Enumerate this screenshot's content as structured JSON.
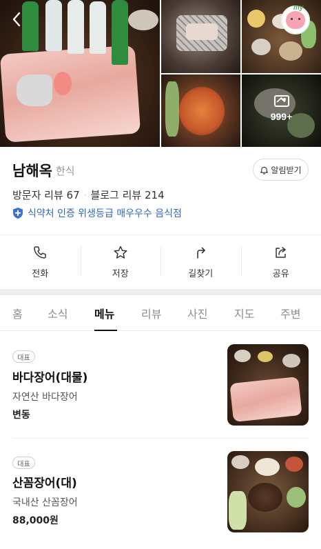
{
  "gallery": {
    "more_count": "999+",
    "profile_label": "my"
  },
  "place": {
    "name": "남해옥",
    "category": "한식",
    "notify_label": "알림받기",
    "visitor_reviews": "방문자 리뷰 67",
    "blog_reviews": "블로그 리뷰 214",
    "certification": "식약처 인증 위생등급 매우우수 음식점"
  },
  "actions": [
    {
      "label": "전화",
      "icon": "phone-icon"
    },
    {
      "label": "저장",
      "icon": "star-icon"
    },
    {
      "label": "길찾기",
      "icon": "directions-icon"
    },
    {
      "label": "공유",
      "icon": "share-icon"
    }
  ],
  "tabs": [
    "홈",
    "소식",
    "메뉴",
    "리뷰",
    "사진",
    "지도",
    "주변"
  ],
  "active_tab": "메뉴",
  "menu": [
    {
      "badge": "대표",
      "name": "바다장어(대물)",
      "description": "자연산 바다장어",
      "price": "변동"
    },
    {
      "badge": "대표",
      "name": "산꼼장어(대)",
      "description": "국내산 산꼼장어",
      "price": "88,000원"
    }
  ],
  "colors": {
    "accent_blue": "#2f68c4",
    "text_primary": "#111111",
    "text_secondary": "#8e8e8e",
    "divider": "#efeff2"
  }
}
